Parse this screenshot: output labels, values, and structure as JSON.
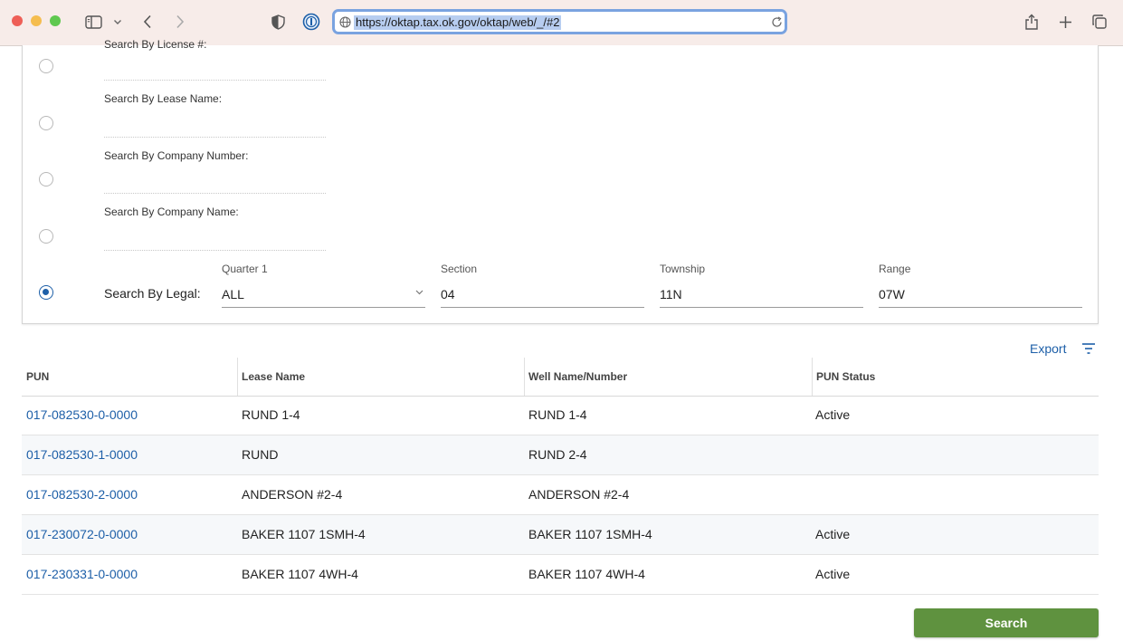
{
  "browser": {
    "url": "https://oktap.tax.ok.gov/oktap/web/_/#2"
  },
  "search_options": [
    {
      "label": "Search By License #:"
    },
    {
      "label": "Search By Lease Name:"
    },
    {
      "label": "Search By Company Number:"
    },
    {
      "label": "Search By Company Name:"
    }
  ],
  "legal": {
    "label": "Search By Legal:",
    "quarter_label": "Quarter 1",
    "quarter_value": "ALL",
    "section_label": "Section",
    "section_value": "04",
    "township_label": "Township",
    "township_value": "11N",
    "range_label": "Range",
    "range_value": "07W"
  },
  "toolbar": {
    "export_label": "Export",
    "search_label": "Search"
  },
  "table": {
    "headers": [
      "PUN",
      "Lease Name",
      "Well Name/Number",
      "PUN Status"
    ],
    "rows": [
      {
        "pun": "017-082530-0-0000",
        "lease": "RUND 1-4",
        "well": "RUND 1-4",
        "status": "Active"
      },
      {
        "pun": "017-082530-1-0000",
        "lease": "RUND",
        "well": "RUND 2-4",
        "status": ""
      },
      {
        "pun": "017-082530-2-0000",
        "lease": "ANDERSON #2-4",
        "well": "ANDERSON #2-4",
        "status": ""
      },
      {
        "pun": "017-230072-0-0000",
        "lease": "BAKER 1107 1SMH-4",
        "well": "BAKER 1107 1SMH-4",
        "status": "Active"
      },
      {
        "pun": "017-230331-0-0000",
        "lease": "BAKER 1107 4WH-4",
        "well": "BAKER 1107 4WH-4",
        "status": "Active"
      }
    ]
  }
}
